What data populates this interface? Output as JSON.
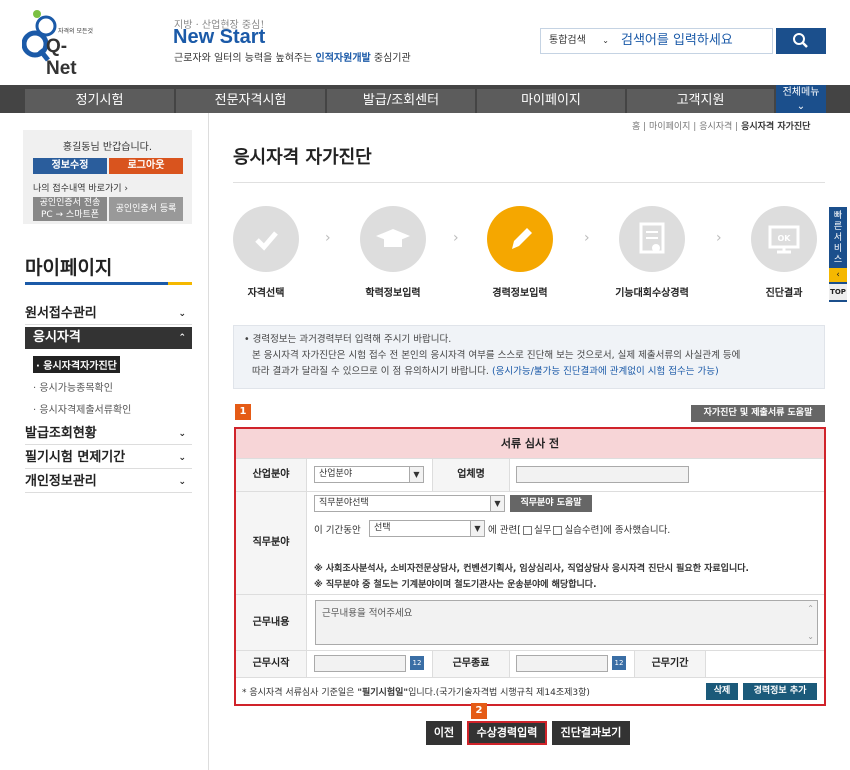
{
  "header": {
    "logo_text": "Q-Net",
    "logo_sub": "자격의 모든것",
    "slogan_top": "지방 · 산업현장 중심!",
    "slogan_main": "New Start",
    "slogan_sub_a": "근로자와 일터의 능력을 높혀주는 ",
    "slogan_sub_b": "인적자원개발",
    "slogan_sub_c": " 중심기관",
    "search_scope": "통합검색",
    "search_placeholder": "검색어를 입력하세요"
  },
  "nav": {
    "items": [
      "정기시험",
      "전문자격시험",
      "발급/조회센터",
      "마이페이지",
      "고객지원"
    ],
    "all_menu": "전체메뉴"
  },
  "sidebar": {
    "greeting": "홍길동님 반갑습니다.",
    "edit_info": "정보수정",
    "logout": "로그아웃",
    "my_receipt": "나의 접수내역 바로가기",
    "cert_transfer_1": "공인인증서 전송",
    "cert_transfer_2": "PC → 스마트폰",
    "cert_register": "공인인증서 등록",
    "title": "마이페이지",
    "menus": [
      {
        "label": "원서접수관리",
        "active": false
      },
      {
        "label": "응시자격",
        "active": true
      },
      {
        "label": "발급조회현황",
        "active": false
      },
      {
        "label": "필기시험 면제기간",
        "active": false
      },
      {
        "label": "개인정보관리",
        "active": false
      }
    ],
    "submenus": [
      "응시자격자가진단",
      "응시가능종목확인",
      "응시자격제출서류확인"
    ]
  },
  "main": {
    "breadcrumb_home": "홈",
    "breadcrumb_mid": " | 마이페이지 | 응시자격 | ",
    "breadcrumb_current": "응시자격 자가진단",
    "title": "응시자격 자가진단",
    "steps": [
      {
        "label": "자격선택",
        "icon": "check-icon",
        "active": false
      },
      {
        "label": "학력정보입력",
        "icon": "graduation-cap-icon",
        "active": false
      },
      {
        "label": "경력정보입력",
        "icon": "pencil-icon",
        "active": true
      },
      {
        "label": "기능대회수상경력",
        "icon": "certificate-icon",
        "active": false
      },
      {
        "label": "진단결과",
        "icon": "monitor-ok-icon",
        "active": false
      }
    ],
    "notice_1": "• 경력정보는 과거경력부터 입력해 주시기 바랍니다.",
    "notice_2": "본 응시자격 자가진단은 시험 접수 전 본인의 응시자격 여부를 스스로 진단해 보는 것으로서, 실제 제출서류의 사실관계 등에",
    "notice_3a": "따라 결과가 달라질 수 있으므로 이 점 유의하시기 바랍니다. ",
    "notice_3b": "(응시가능/불가능 진단결과에 관계없이 시험 접수는 가능)",
    "badge_1": "1",
    "badge_2": "2",
    "help_button": "자가진단 및 제출서류 도움말",
    "form": {
      "header": "서류 심사 전",
      "industry_label": "산업분야",
      "industry_value": "산업분야",
      "company_label": "업체명",
      "job_label": "직무분야",
      "job_value": "직무분야선택",
      "job_help": "직무분야 도움말",
      "period_prefix": "이 기간동안",
      "period_value": "선택",
      "period_related": "에 관련[",
      "opt_practice": "실무",
      "opt_training": "실습수련",
      "period_suffix": "]에 종사했습니다.",
      "note_1": "※ 사회조사분석사, 소비자전문상담사, 컨벤션기획사, 임상심리사, 직업상담사 응시자격 진단시 필요한 자료입니다.",
      "note_2": "※ 직무분야 중 철도는 기계분야이며 철도기관사는 운송분야에 해당합니다.",
      "content_label": "근무내용",
      "content_placeholder": "근무내용을 적어주세요",
      "start_label": "근무시작",
      "end_label": "근무종료",
      "period_label": "근무기간",
      "calendar_label": "12",
      "footnote_a": "* 응시자격 서류심사 기준일은 ",
      "footnote_b": "\"필기시험일\"",
      "footnote_c": "입니다.(국가기술자격법 시행규칙 제14조제3항)",
      "delete_button": "삭제",
      "add_button": "경력정보 추가"
    },
    "buttons": {
      "prev": "이전",
      "award": "수상경력입력",
      "result": "진단결과보기"
    }
  },
  "quick": {
    "label": "빠른서비스",
    "top": "TOP"
  }
}
